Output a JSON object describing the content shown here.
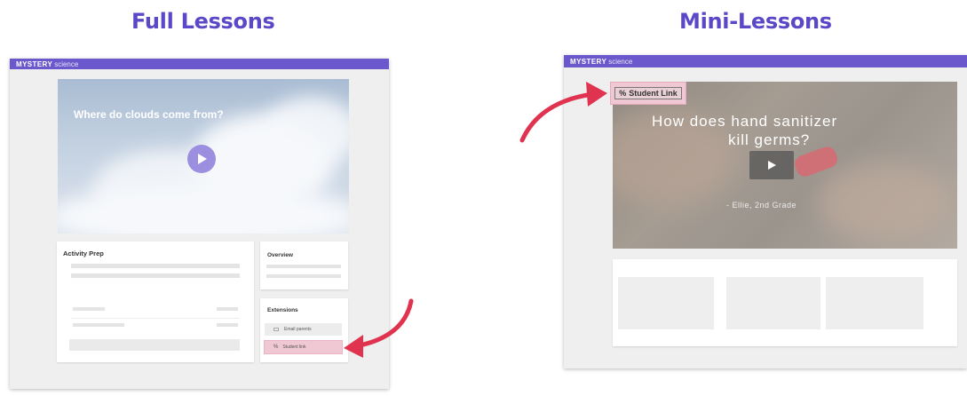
{
  "headings": {
    "full": "Full Lessons",
    "mini": "Mini-Lessons"
  },
  "colors": {
    "heading": "#5a48c8",
    "topbar": "#6a58cc",
    "highlight": "#f0c8d4",
    "arrow": "#e0334f"
  },
  "full_lesson": {
    "brand_bold": "MYSTERY",
    "brand_light": "science",
    "video_title": "Where do clouds come from?",
    "activity_prep_title": "Activity Prep",
    "overview_title": "Overview",
    "extensions_title": "Extensions",
    "extensions": [
      {
        "icon": "envelope-icon",
        "label": "Email parents"
      },
      {
        "icon": "link-icon",
        "label": "Student link"
      }
    ]
  },
  "mini_lesson": {
    "brand_bold": "MYSTERY",
    "brand_light": "science",
    "student_link_label": "Student Link",
    "video_title_line1": "How does hand sanitizer",
    "video_title_line2": "kill germs?",
    "video_credit": "- Ellie, 2nd Grade"
  }
}
